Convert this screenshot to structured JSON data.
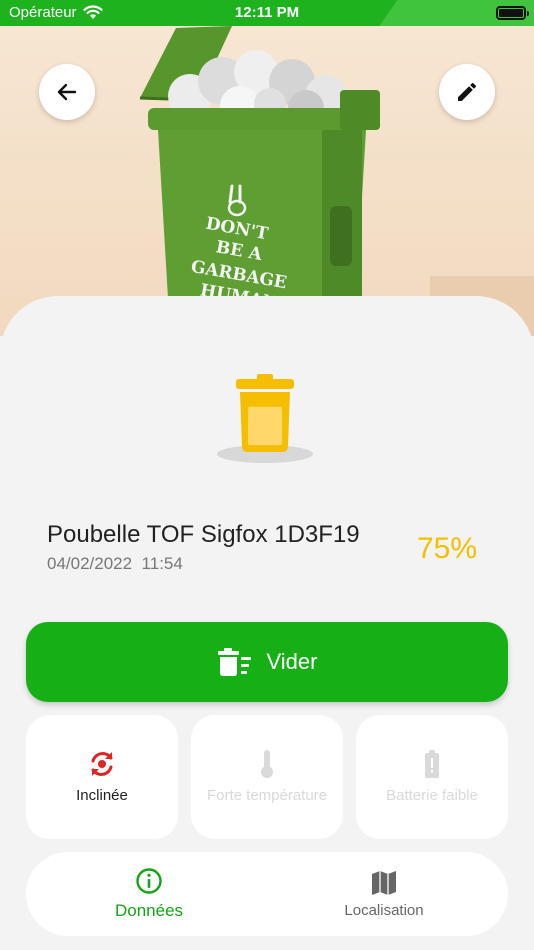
{
  "status_bar": {
    "carrier": "Opérateur",
    "time": "12:11 PM"
  },
  "hero": {
    "bin_slogan": [
      "DON'T",
      "BE A",
      "GARBAGE",
      "HUMAN"
    ]
  },
  "bin": {
    "title": "Poubelle TOF Sigfox 1D3F19",
    "date": "04/02/2022",
    "time": "11:54",
    "fill_percent_label": "75%",
    "fill_level": 0.75
  },
  "actions": {
    "empty_label": "Vider"
  },
  "alerts": [
    {
      "label": "Inclinée",
      "active": true
    },
    {
      "label": "Forte température",
      "active": false
    },
    {
      "label": "Batterie faible",
      "active": false
    }
  ],
  "nav": {
    "data_label": "Données",
    "location_label": "Localisation"
  },
  "colors": {
    "primary_green": "#16b016",
    "fill_yellow": "#f6be00",
    "alert_red": "#e02424"
  }
}
